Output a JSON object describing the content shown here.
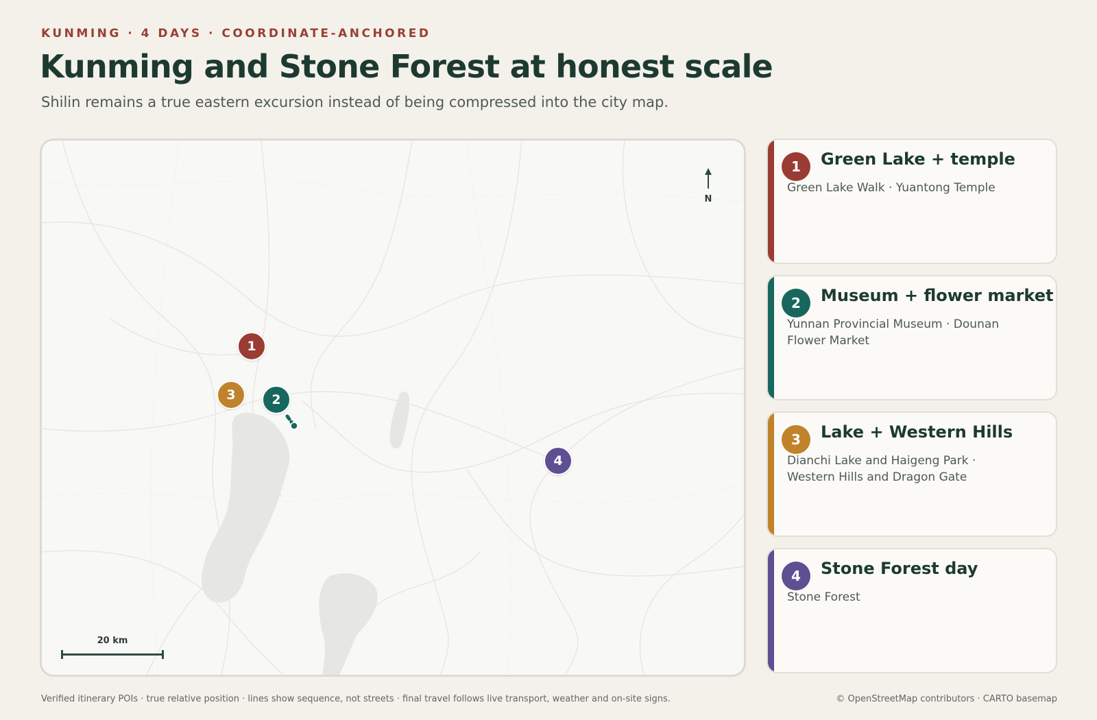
{
  "header": {
    "eyebrow": "KUNMING · 4 DAYS · COORDINATE-ANCHORED",
    "title": "Kunming and Stone Forest at honest scale",
    "subtitle": "Shilin remains a true eastern excursion instead of being compressed into the city map."
  },
  "map": {
    "north_label": "N",
    "scale_label": "20 km",
    "markers": [
      {
        "label": "1",
        "color": "#9a3c33"
      },
      {
        "label": "2",
        "color": "#17675e"
      },
      {
        "label": "3",
        "color": "#c0822a"
      },
      {
        "label": "4",
        "color": "#5e4f93"
      }
    ]
  },
  "days": [
    {
      "num": "1",
      "title": "Green Lake + temple",
      "desc": "Green Lake Walk · Yuantong Temple",
      "color": "#9a3c33"
    },
    {
      "num": "2",
      "title": "Museum + flower market",
      "desc": "Yunnan Provincial Museum · Dounan Flower Market",
      "color": "#17675e"
    },
    {
      "num": "3",
      "title": "Lake + Western Hills",
      "desc": "Dianchi Lake and Haigeng Park · Western Hills and Dragon Gate",
      "color": "#c0822a"
    },
    {
      "num": "4",
      "title": "Stone Forest day",
      "desc": "Stone Forest",
      "color": "#5e4f93"
    }
  ],
  "footer": {
    "note": "Verified itinerary POIs · true relative position · lines show sequence, not streets · final travel follows live transport, weather and on-site signs.",
    "attribution": "© OpenStreetMap contributors · CARTO basemap"
  }
}
